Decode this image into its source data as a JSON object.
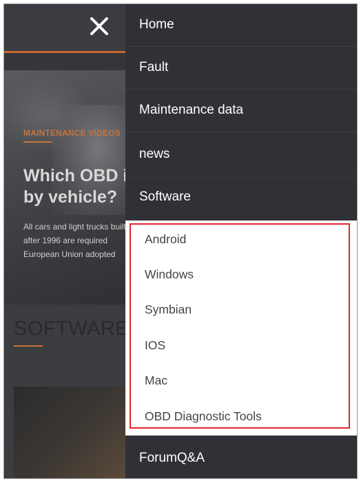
{
  "background": {
    "article_tag": "MAINTENANCE VIDEOS",
    "article_title_lines": [
      "Which OBD interface",
      "by vehicle?"
    ],
    "article_body_lines": [
      "All cars and light trucks built",
      "after 1996 are required",
      "European Union adopted"
    ],
    "section_title": "SOFTWARE"
  },
  "menu": {
    "items": [
      {
        "label": "Home"
      },
      {
        "label": "Fault"
      },
      {
        "label": "Maintenance data"
      },
      {
        "label": "news"
      },
      {
        "label": "Software"
      }
    ],
    "submenu": [
      {
        "label": "Android"
      },
      {
        "label": "Windows"
      },
      {
        "label": "Symbian"
      },
      {
        "label": "IOS"
      },
      {
        "label": "Mac"
      },
      {
        "label": "OBD Diagnostic Tools"
      }
    ],
    "forum_label": "ForumQ&A"
  },
  "colors": {
    "menu_bg": "#2f3136",
    "accent_orange": "#c8733a",
    "highlight_red": "#e0262b"
  },
  "icons": {
    "close": "close-icon"
  }
}
